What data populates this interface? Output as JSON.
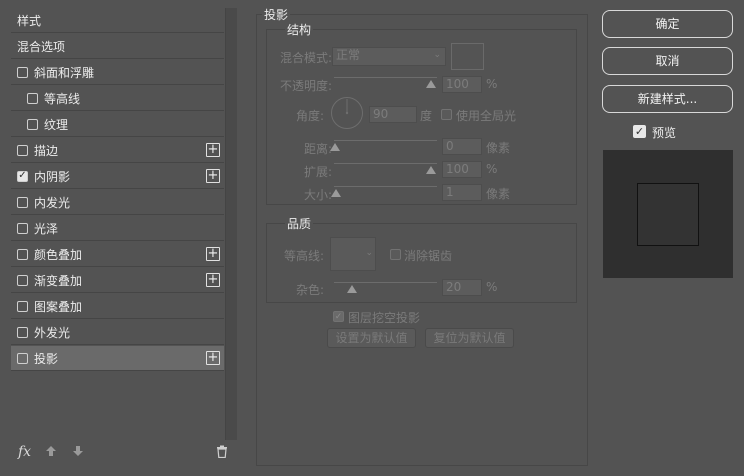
{
  "styles_list": {
    "items": [
      {
        "label": "样式",
        "kind": "head",
        "checked": null,
        "plus": false,
        "selected": false
      },
      {
        "label": "混合选项",
        "kind": "head",
        "checked": null,
        "plus": false,
        "selected": false
      },
      {
        "label": "斜面和浮雕",
        "kind": "item",
        "checked": false,
        "plus": false,
        "selected": false
      },
      {
        "label": "等高线",
        "kind": "sub",
        "checked": false,
        "plus": false,
        "selected": false
      },
      {
        "label": "纹理",
        "kind": "sub",
        "checked": false,
        "plus": false,
        "selected": false
      },
      {
        "label": "描边",
        "kind": "item",
        "checked": false,
        "plus": true,
        "selected": false
      },
      {
        "label": "内阴影",
        "kind": "item",
        "checked": true,
        "plus": true,
        "selected": false
      },
      {
        "label": "内发光",
        "kind": "item",
        "checked": false,
        "plus": false,
        "selected": false
      },
      {
        "label": "光泽",
        "kind": "item",
        "checked": false,
        "plus": false,
        "selected": false
      },
      {
        "label": "颜色叠加",
        "kind": "item",
        "checked": false,
        "plus": true,
        "selected": false
      },
      {
        "label": "渐变叠加",
        "kind": "item",
        "checked": false,
        "plus": true,
        "selected": false
      },
      {
        "label": "图案叠加",
        "kind": "item",
        "checked": false,
        "plus": false,
        "selected": false
      },
      {
        "label": "外发光",
        "kind": "item",
        "checked": false,
        "plus": false,
        "selected": false
      },
      {
        "label": "投影",
        "kind": "item",
        "checked": false,
        "plus": true,
        "selected": true
      }
    ],
    "fx_label": "fx",
    "icons": {
      "fx": "fx-icon",
      "up": "arrow-up-icon",
      "down": "arrow-down-icon",
      "trash": "trash-icon"
    }
  },
  "drop_shadow": {
    "title": "投影",
    "structure": {
      "title": "结构",
      "blend_mode_label": "混合模式:",
      "blend_mode_value": "正常",
      "opacity_label": "不透明度:",
      "opacity_value": "100",
      "opacity_unit": "%",
      "angle_label": "角度:",
      "angle_value": "90",
      "angle_unit": "度",
      "global_light_label": "使用全局光",
      "distance_label": "距离:",
      "distance_value": "0",
      "distance_unit": "像素",
      "spread_label": "扩展:",
      "spread_value": "100",
      "spread_unit": "%",
      "size_label": "大小:",
      "size_value": "1",
      "size_unit": "像素"
    },
    "quality": {
      "title": "品质",
      "contour_label": "等高线:",
      "antialias_label": "消除锯齿",
      "noise_label": "杂色:",
      "noise_value": "20",
      "noise_unit": "%"
    },
    "knockout_label": "图层挖空投影",
    "make_default_label": "设置为默认值",
    "reset_default_label": "复位为默认值"
  },
  "actions": {
    "ok_label": "确定",
    "cancel_label": "取消",
    "new_style_label": "新建样式...",
    "preview_label": "预览",
    "preview_checked": true
  }
}
